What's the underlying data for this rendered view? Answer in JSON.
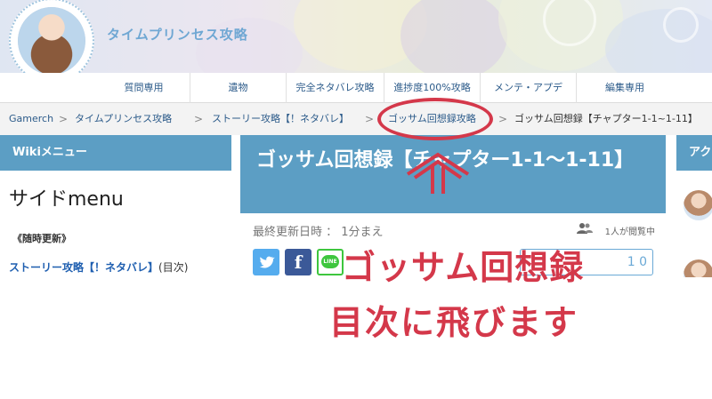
{
  "site": {
    "title": "タイムプリンセス攻略"
  },
  "nav": {
    "items": [
      {
        "label": "質問専用"
      },
      {
        "label": "遺物"
      },
      {
        "label": "完全ネタバレ攻略"
      },
      {
        "label": "進捗度100%攻略"
      },
      {
        "label": "メンテ・アプデ"
      },
      {
        "label": "編集専用"
      }
    ]
  },
  "breadcrumb": {
    "items": [
      {
        "label": "Gamerch"
      },
      {
        "label": "タイムプリンセス攻略"
      },
      {
        "label": "ストーリー攻略【！ネタバレ】"
      },
      {
        "label": "ゴッサム回想録攻略"
      },
      {
        "label": "ゴッサム回想録【チャプター1-1~1-11】"
      }
    ],
    "separator": ">"
  },
  "sidebar": {
    "header": "Wikiメニュー",
    "title": "サイドmenu",
    "subheading": "《随時更新》",
    "link_label": "ストーリー攻略【！ネタバレ】",
    "link_suffix": "(目次)"
  },
  "main": {
    "page_title": "ゴッサム回想録【チャプター1-1〜1-11】",
    "updated": "最終更新日時 ： 1分まえ",
    "viewers": "1人が閲覧中",
    "share_twitter": "twitter-icon",
    "share_facebook": "f",
    "share_line": "LINE",
    "counter": "1 0"
  },
  "rightbar": {
    "header": "アク"
  },
  "annotation": {
    "line1": "ゴッサム回想録",
    "line2": "目次に飛びます",
    "color": "#d4384a"
  },
  "colors": {
    "accent_blue": "#5c9ec4",
    "link_blue": "#2c5b8a",
    "annotation_red": "#d4384a"
  }
}
